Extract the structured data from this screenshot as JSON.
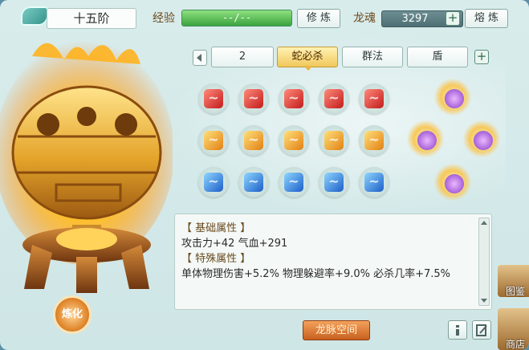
{
  "header": {
    "tier": "十五阶",
    "exp_label": "经验",
    "exp_value": "--/--",
    "exp_progress": 1.0,
    "cultivate_label": "修 炼",
    "soul_label": "龙魂",
    "soul_value": "3297",
    "smelt_label": "熔 炼"
  },
  "tabs": {
    "page": "2",
    "items": [
      "蛇必杀",
      "群法",
      "盾"
    ],
    "active": 0
  },
  "gems": {
    "rows": [
      {
        "color": "red",
        "count": 5
      },
      {
        "color": "orange",
        "count": 5
      },
      {
        "color": "blue",
        "count": 5
      }
    ],
    "stars": 4
  },
  "attributes": {
    "base_title": "【 基础属性 】",
    "base_line": "攻击力+42  气血+291",
    "special_title": "【 特殊属性 】",
    "special_line": "单体物理伤害+5.2%  物理躲避率+9.0%  必杀几率+7.5%"
  },
  "buttons": {
    "refine": "炼化",
    "space": "龙脉空间"
  },
  "side": {
    "atlas": "图鉴",
    "shop": "商店"
  },
  "colors": {
    "accent_gold": "#f1c85a",
    "exp_green": "#3aa33e",
    "panel_bg": "#d9ecec"
  }
}
